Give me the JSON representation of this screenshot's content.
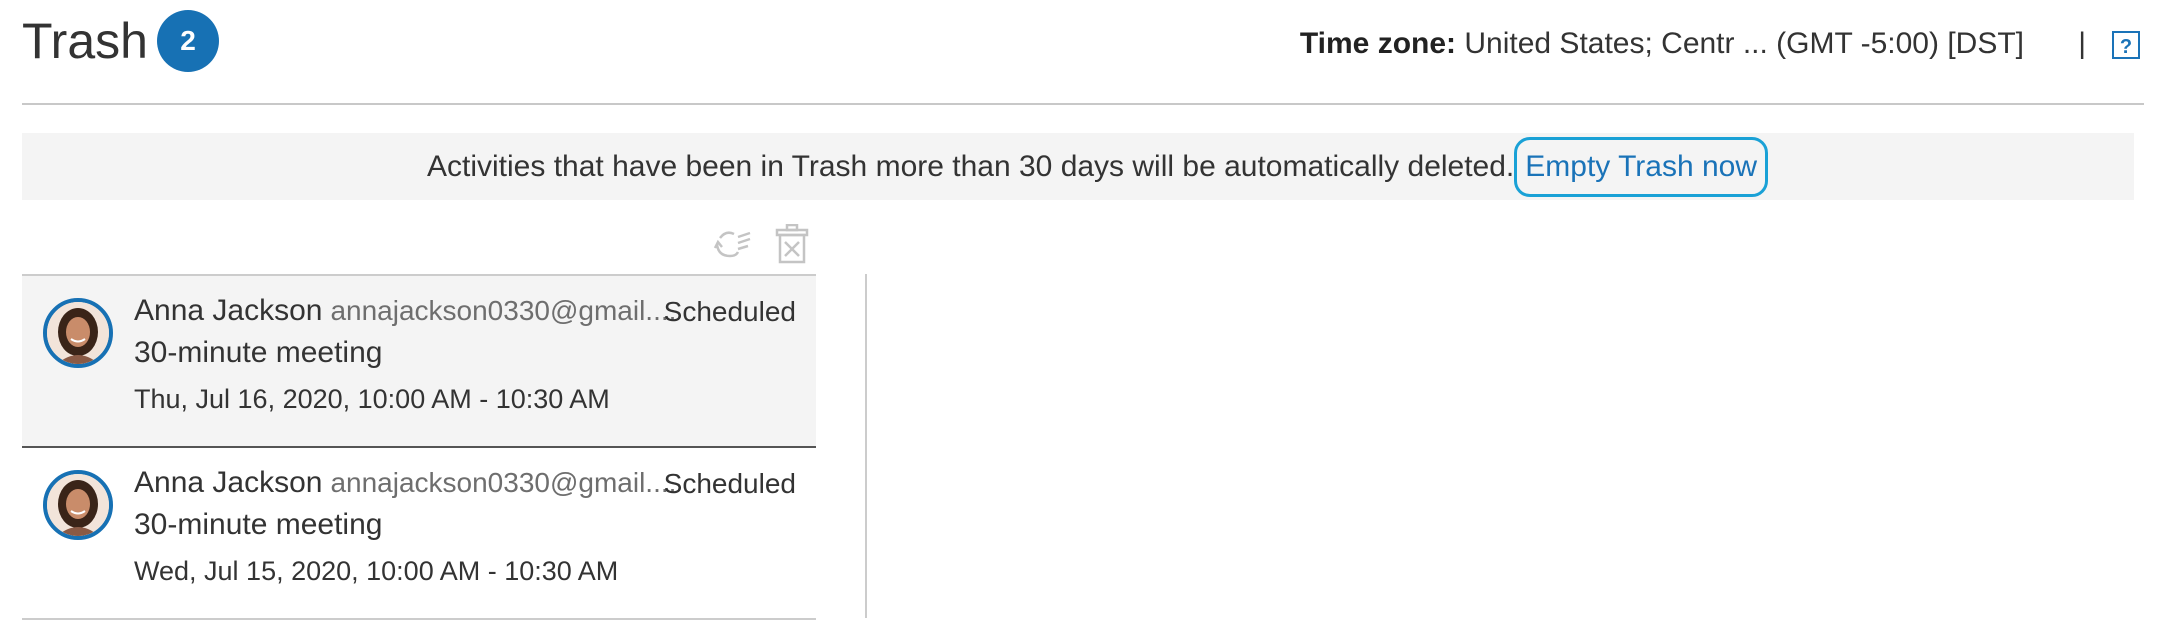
{
  "header": {
    "title": "Trash",
    "count": "2",
    "timezone_label": "Time zone:",
    "timezone_value": "United States; Centr ... (GMT -5:00) [DST]",
    "separator": "|",
    "help_label": "?"
  },
  "banner": {
    "message": "Activities that have been in Trash more than 30 days will be automatically deleted.",
    "empty_trash_label": "Empty Trash now"
  },
  "toolbar": {
    "restore_icon": "restore-icon",
    "delete_icon": "delete-permanently-icon"
  },
  "activities": [
    {
      "name": "Anna Jackson",
      "email": "annajackson0330@gmail....",
      "status": "Scheduled",
      "subject": "30-minute meeting",
      "datetime": "Thu, Jul 16, 2020, 10:00 AM - 10:30 AM"
    },
    {
      "name": "Anna Jackson",
      "email": "annajackson0330@gmail....",
      "status": "Scheduled",
      "subject": "30-minute meeting",
      "datetime": "Wed, Jul 15, 2020, 10:00 AM - 10:30 AM"
    }
  ],
  "colors": {
    "accent": "#1771b4",
    "link": "#1a73b8",
    "focus_ring": "#1aa1d6",
    "banner_bg": "#f4f4f4"
  }
}
